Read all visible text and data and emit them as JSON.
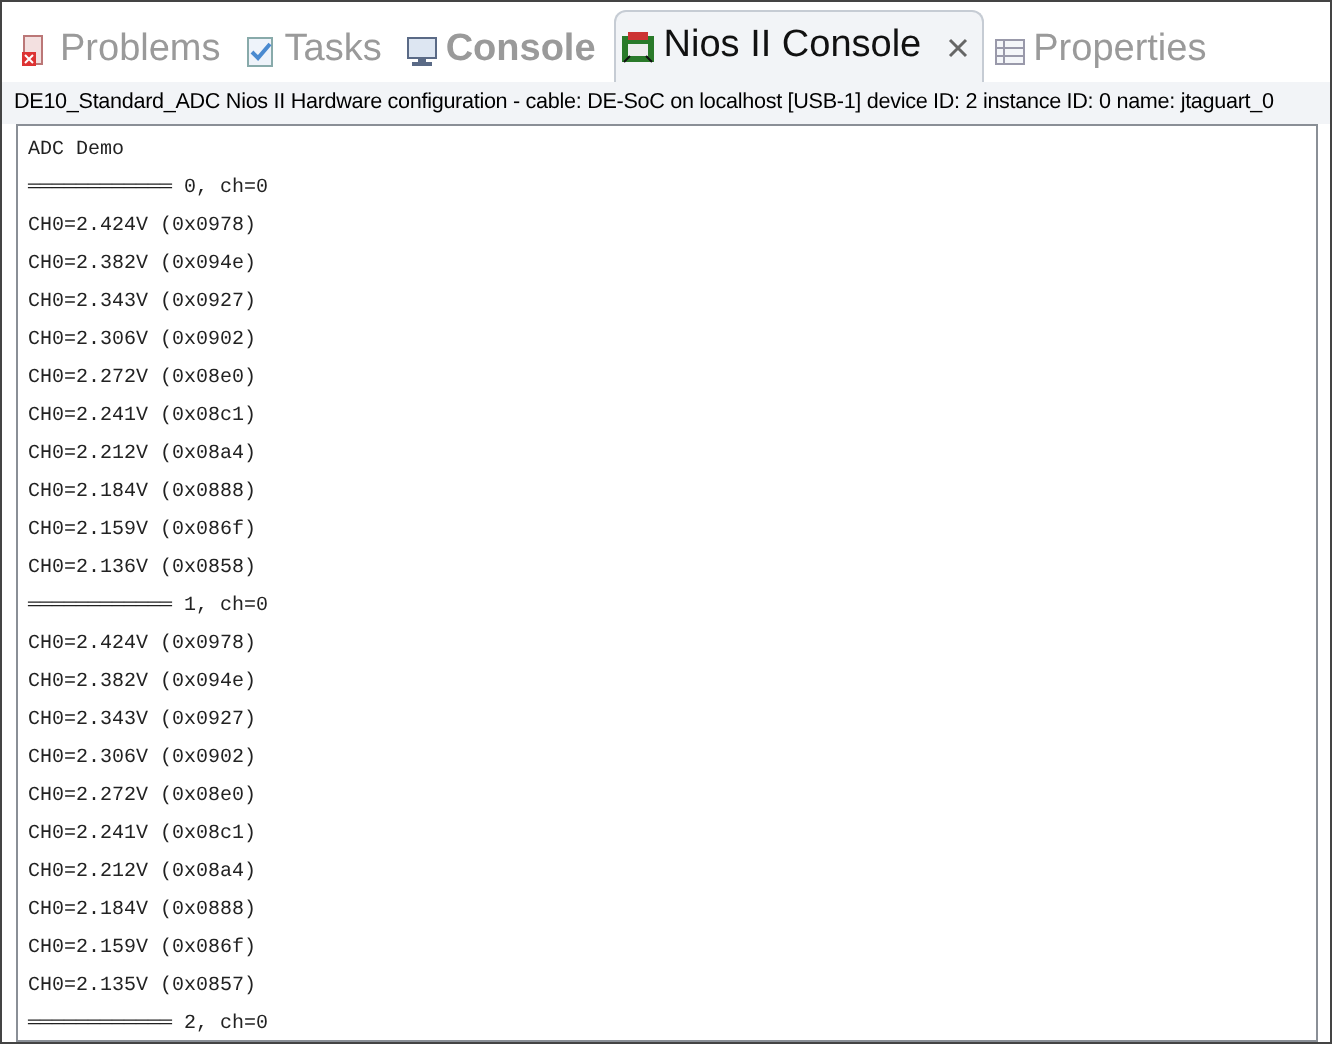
{
  "tabs": [
    {
      "label": "Problems",
      "selected": false,
      "bold": false
    },
    {
      "label": "Tasks",
      "selected": false,
      "bold": false
    },
    {
      "label": "Console",
      "selected": false,
      "bold": true
    },
    {
      "label": "Nios II Console",
      "selected": true,
      "bold": false
    },
    {
      "label": "Properties",
      "selected": false,
      "bold": false
    }
  ],
  "description": "DE10_Standard_ADC Nios II Hardware configuration - cable: DE-SoC on localhost [USB-1] device ID: 2 instance ID: 0 name: jtaguart_0",
  "console_lines": [
    "ADC Demo",
    "════════════ 0, ch=0",
    "CH0=2.424V (0x0978)",
    "CH0=2.382V (0x094e)",
    "CH0=2.343V (0x0927)",
    "CH0=2.306V (0x0902)",
    "CH0=2.272V (0x08e0)",
    "CH0=2.241V (0x08c1)",
    "CH0=2.212V (0x08a4)",
    "CH0=2.184V (0x0888)",
    "CH0=2.159V (0x086f)",
    "CH0=2.136V (0x0858)",
    "════════════ 1, ch=0",
    "CH0=2.424V (0x0978)",
    "CH0=2.382V (0x094e)",
    "CH0=2.343V (0x0927)",
    "CH0=2.306V (0x0902)",
    "CH0=2.272V (0x08e0)",
    "CH0=2.241V (0x08c1)",
    "CH0=2.212V (0x08a4)",
    "CH0=2.184V (0x0888)",
    "CH0=2.159V (0x086f)",
    "CH0=2.135V (0x0857)",
    "════════════ 2, ch=0"
  ]
}
